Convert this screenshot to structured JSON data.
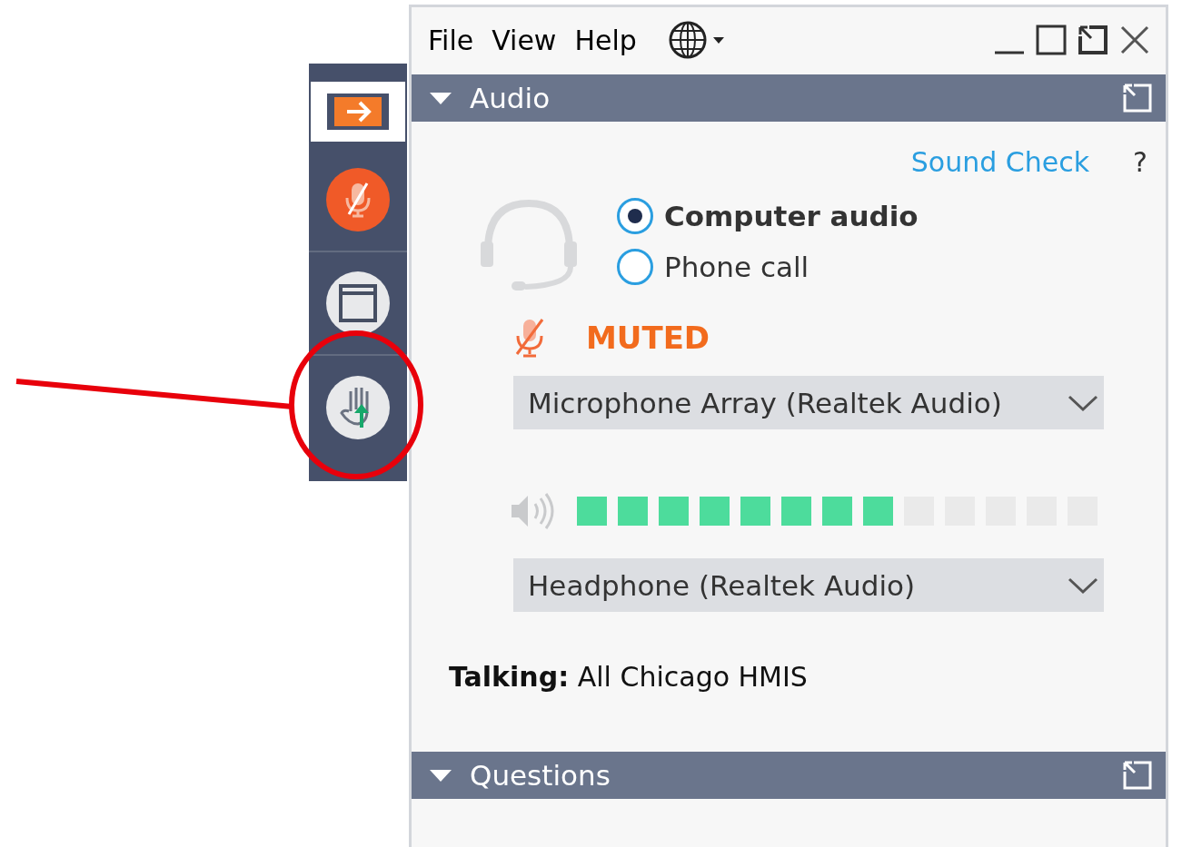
{
  "sidebar": {
    "buttons": [
      {
        "kind": "arrow",
        "selected": true
      },
      {
        "kind": "mic",
        "selected": false
      },
      {
        "kind": "window",
        "selected": false
      },
      {
        "kind": "hand",
        "selected": false
      }
    ]
  },
  "menu": [
    {
      "label": "File"
    },
    {
      "label": "View"
    },
    {
      "label": "Help"
    }
  ],
  "audio": {
    "title": "Audio",
    "expanded": true,
    "sound_check": "Sound Check",
    "help": "?",
    "options": [
      {
        "label": "Computer audio",
        "selected": true
      },
      {
        "label": "Phone call",
        "selected": false
      }
    ],
    "muted": true,
    "mute_status": "MUTED",
    "microphone": "Microphone Array (Realtek Audio)",
    "speaker_meter": {
      "level": 0.615
    },
    "speaker": "Headphone (Realtek Audio)",
    "talking_label": "Talking:",
    "talking": "All Chicago HMIS"
  },
  "questions": {
    "title": "Questions",
    "expanded": true
  }
}
